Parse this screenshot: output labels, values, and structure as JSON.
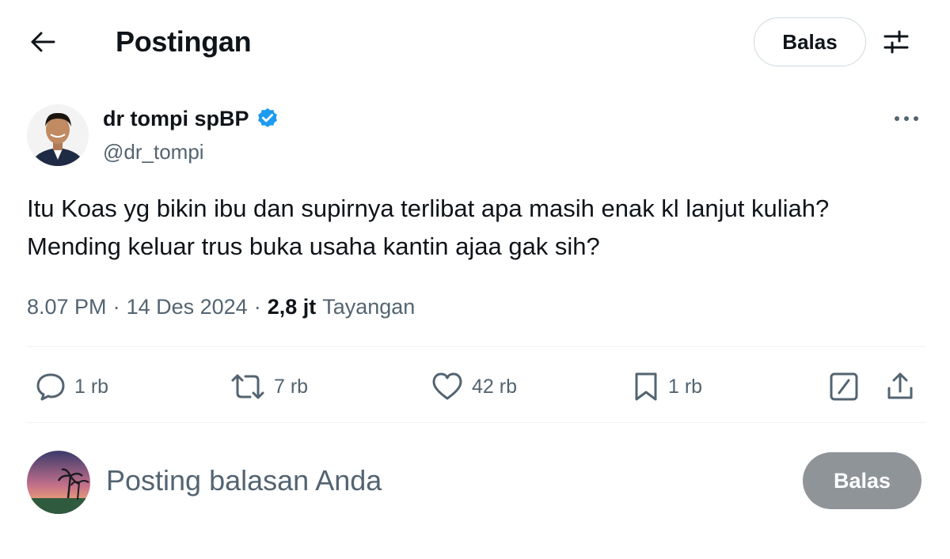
{
  "header": {
    "title": "Postingan",
    "reply_label": "Balas"
  },
  "author": {
    "display_name": "dr tompi spBP",
    "handle": "@dr_tompi"
  },
  "post": {
    "text": "Itu Koas yg bikin ibu dan supirnya terlibat apa masih enak kl lanjut kuliah? Mending keluar trus buka usaha kantin ajaa gak sih?",
    "time": "8.07 PM",
    "date": "14 Des 2024",
    "views_count": "2,8 jt",
    "views_label": "Tayangan"
  },
  "actions": {
    "replies": "1 rb",
    "reposts": "7 rb",
    "likes": "42 rb",
    "bookmarks": "1 rb"
  },
  "composer": {
    "placeholder": "Posting balasan Anda",
    "submit_label": "Balas"
  },
  "colors": {
    "text": "#0f1419",
    "secondary": "#536471",
    "verified": "#1d9bf0",
    "divider": "#eff3f4",
    "disabled_button": "#8f9499"
  },
  "icons": {
    "back": "arrow-left-icon",
    "filter": "sliders-icon",
    "verified": "verified-badge-icon",
    "more": "more-horizontal-icon",
    "reply": "comment-icon",
    "repost": "repost-icon",
    "like": "heart-icon",
    "bookmark": "bookmark-icon",
    "grok": "grok-icon",
    "share": "share-icon"
  }
}
